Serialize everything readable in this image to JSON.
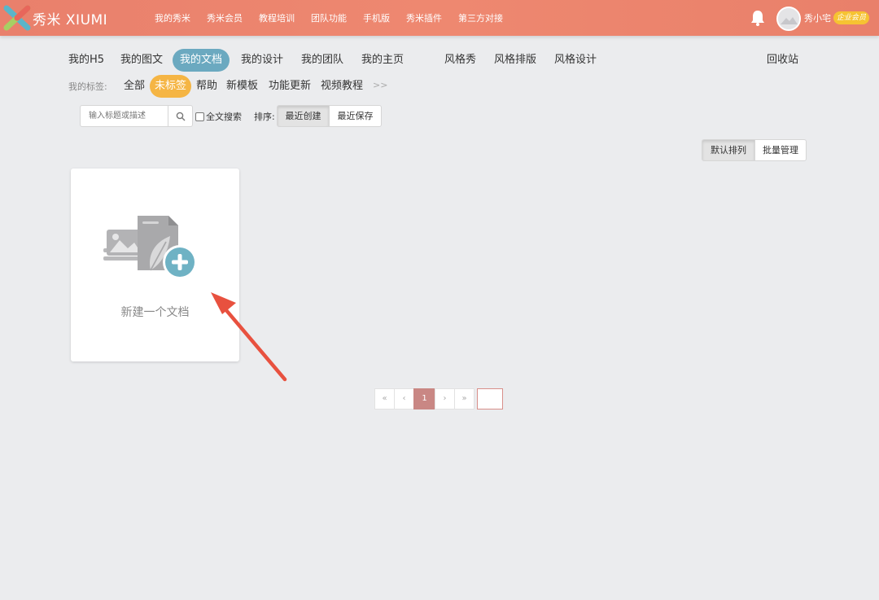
{
  "header": {
    "logo_text": "秀米 XIUMI",
    "nav": [
      "我的秀米",
      "秀米会员",
      "教程培训",
      "团队功能",
      "手机版",
      "秀米插件",
      "第三方对接"
    ],
    "username": "秀小宅",
    "badge": "企业会员"
  },
  "tabs": {
    "items": [
      {
        "label": "我的H5"
      },
      {
        "label": "我的图文"
      },
      {
        "label": "我的文档",
        "active": true
      },
      {
        "label": "我的设计"
      },
      {
        "label": "我的团队"
      },
      {
        "label": "我的主页"
      },
      {
        "label": "风格秀"
      },
      {
        "label": "风格排版"
      },
      {
        "label": "风格设计"
      },
      {
        "label": "回收站"
      }
    ]
  },
  "tags": {
    "label": "我的标签:",
    "items": [
      {
        "label": "全部"
      },
      {
        "label": "未标签",
        "active": true
      },
      {
        "label": "帮助"
      },
      {
        "label": "新模板"
      },
      {
        "label": "功能更新"
      },
      {
        "label": "视频教程"
      }
    ],
    "more": ">>"
  },
  "search": {
    "placeholder": "输入标题或描述",
    "fulltext_label": "全文搜索"
  },
  "sort": {
    "label": "排序:",
    "recent_created": "最近创建",
    "recent_saved": "最近保存"
  },
  "view": {
    "default_order": "默认排列",
    "batch_manage": "批量管理"
  },
  "card": {
    "label": "新建一个文档"
  },
  "pagination": {
    "first": "«",
    "prev": "‹",
    "current": "1",
    "next": "›",
    "last": "»"
  },
  "colors": {
    "header": "#ee8870",
    "active_tab": "#6ba9c0",
    "active_tag": "#f5b544",
    "badge": "#f6c332",
    "arrow": "#e8513f",
    "page_current": "#c98784"
  }
}
